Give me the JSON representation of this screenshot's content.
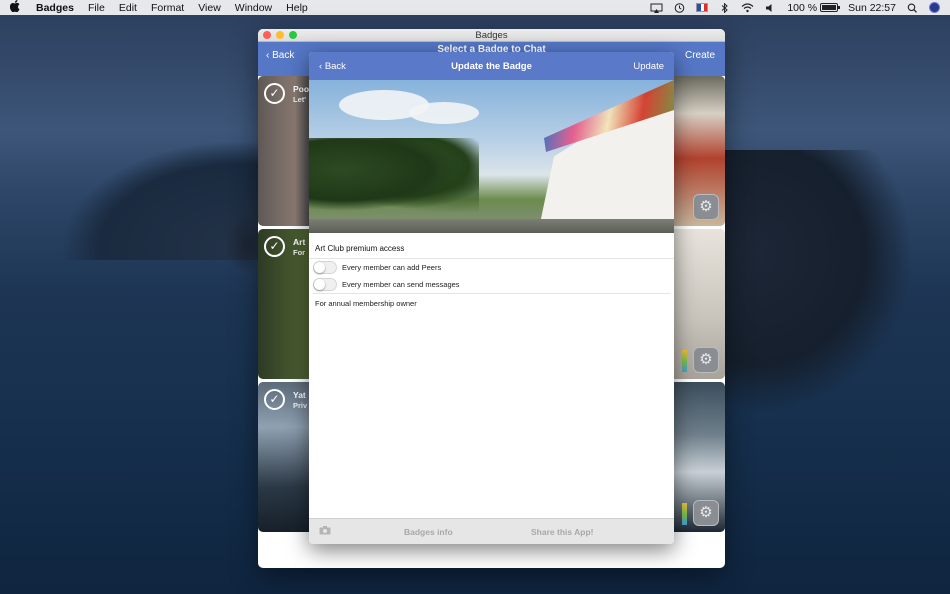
{
  "menubar": {
    "app_name": "Badges",
    "items": [
      "File",
      "Edit",
      "Format",
      "View",
      "Window",
      "Help"
    ],
    "battery_percent": "100 %",
    "battery_level": 1.0,
    "clock": "Sun 22:57",
    "status_icons": [
      "airplay-icon",
      "time-machine-icon",
      "flag-fr-icon",
      "bluetooth-icon",
      "wifi-icon",
      "volume-icon",
      "battery-icon",
      "spotlight-icon",
      "siri-icon"
    ]
  },
  "window": {
    "title": "Badges",
    "nav": {
      "back_label": "Back",
      "title": "Select a Badge to Chat",
      "create_label": "Create"
    },
    "cards": [
      {
        "title": "Poo",
        "subtitle": "Let'"
      },
      {
        "title": "Art",
        "subtitle": "For"
      },
      {
        "title": "Yat",
        "subtitle": "Priv"
      }
    ]
  },
  "sheet": {
    "nav": {
      "back_label": "Back",
      "title": "Update the Badge",
      "update_label": "Update"
    },
    "badge_name": "Art Club premium access",
    "toggles": [
      {
        "label": "Every member can add Peers",
        "on": false
      },
      {
        "label": "Every member can send messages",
        "on": false
      }
    ],
    "description": "For annual membership owner",
    "footer": {
      "info_label": "Badges info",
      "share_label": "Share this App!"
    }
  },
  "colors": {
    "nav_blue": "#5577c6",
    "sheet_nav_blue": "#5a79c8",
    "close": "#fe5f57",
    "minimize": "#febc2e",
    "maximize": "#28c840"
  }
}
